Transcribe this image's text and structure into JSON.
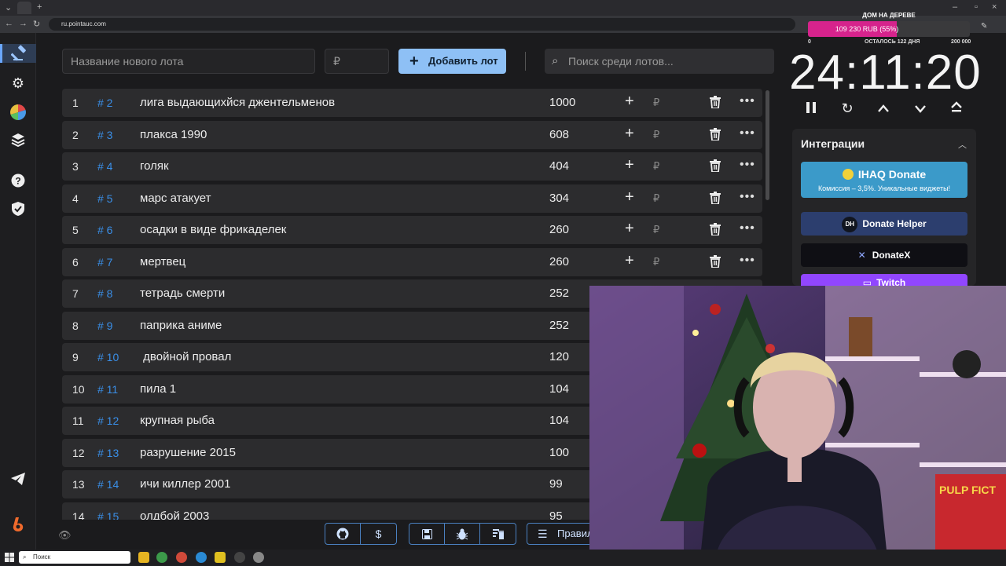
{
  "browser": {
    "url": "ru.pointauc.com"
  },
  "lot_form": {
    "name_placeholder": "Название нового лота",
    "amount_placeholder": "₽",
    "add_label": "Добавить лот",
    "search_placeholder": "Поиск среди лотов..."
  },
  "lots": [
    {
      "index": "1",
      "id": "# 2",
      "name": "лига выдающихйся джентельменов",
      "amount": "1000"
    },
    {
      "index": "2",
      "id": "# 3",
      "name": "плакса 1990",
      "amount": "608"
    },
    {
      "index": "3",
      "id": "# 4",
      "name": "голяк",
      "amount": "404"
    },
    {
      "index": "4",
      "id": "# 5",
      "name": "марс атакует",
      "amount": "304"
    },
    {
      "index": "5",
      "id": "# 6",
      "name": "осадки в виде фрикаделек",
      "amount": "260"
    },
    {
      "index": "6",
      "id": "# 7",
      "name": "мертвец",
      "amount": "260"
    },
    {
      "index": "7",
      "id": "# 8",
      "name": "тетрадь смерти",
      "amount": "252"
    },
    {
      "index": "8",
      "id": "# 9",
      "name": "паприка аниме",
      "amount": "252"
    },
    {
      "index": "9",
      "id": "# 10",
      "name": " двойной провал",
      "amount": "120"
    },
    {
      "index": "10",
      "id": "# 11",
      "name": "пила 1",
      "amount": "104"
    },
    {
      "index": "11",
      "id": "# 12",
      "name": "крупная рыба",
      "amount": "104"
    },
    {
      "index": "12",
      "id": "# 13",
      "name": "разрушение 2015",
      "amount": "100"
    },
    {
      "index": "13",
      "id": "# 14",
      "name": "ичи киллер 2001",
      "amount": "99"
    },
    {
      "index": "14",
      "id": "# 15",
      "name": "олдбой 2003",
      "amount": "95"
    }
  ],
  "row_currency": "₽",
  "bottom": {
    "rules_label": "Правил"
  },
  "goal": {
    "title": "ДОМ НА ДЕРЕВЕ",
    "progress_text": "109 230 RUB (55%)",
    "progress_fraction": 0.55,
    "min": "0",
    "remaining": "ОСТАЛОСЬ 122 ДНЯ",
    "max": "200 000"
  },
  "timer": {
    "value": "24:11:20"
  },
  "integrations": {
    "title": "Интеграции",
    "ihaq_title": "IHAQ Donate",
    "ihaq_subtitle": "Комиссия – 3,5%. Уникальные виджеты!",
    "donate_helper": "Donate Helper",
    "donatex": "DonateX",
    "twitch": "Twitch"
  },
  "taskbar": {
    "search_label": "Поиск"
  },
  "colors": {
    "accent": "#8ec0f5",
    "lot_id": "#3a8fe8",
    "goal_fill": "#d6238c",
    "ihaq": "#3b9ac9",
    "twitch": "#9146ff"
  }
}
